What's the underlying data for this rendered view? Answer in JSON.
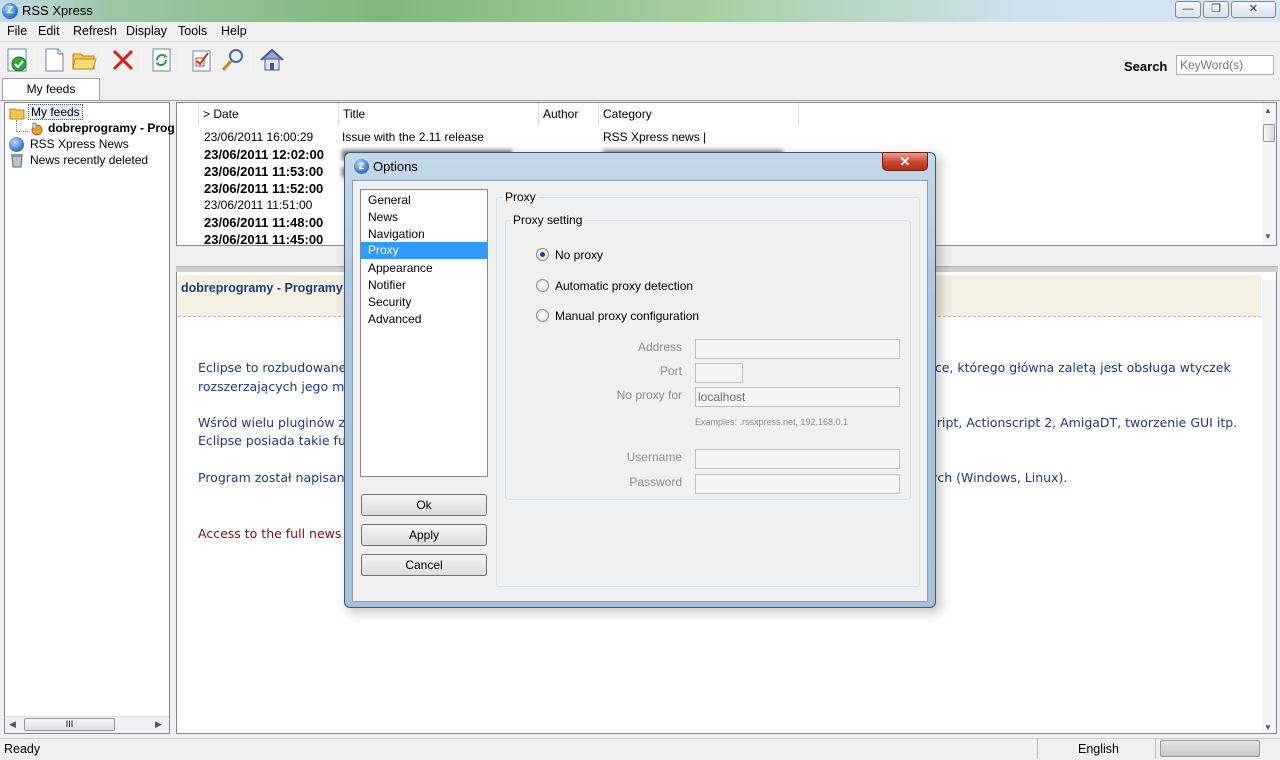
{
  "app": {
    "title": "RSS Xpress",
    "logo": "Z"
  },
  "window_controls": {
    "minimize": "—",
    "maximize": "❐",
    "close": "✕"
  },
  "menu": [
    "File",
    "Edit",
    "Refresh",
    "Display",
    "Tools",
    "Help"
  ],
  "toolbar": {
    "icons": [
      "check-feed-icon",
      "new-document-icon",
      "open-folder-icon",
      "delete-icon",
      "refresh-icon",
      "options-icon",
      "find-icon",
      "home-icon"
    ],
    "search_label": "Search",
    "search_placeholder": "KeyWord(s)"
  },
  "tabs": {
    "my_feeds": "My feeds"
  },
  "tree": {
    "root": "My feeds",
    "child": "dobreprogramy - Prog",
    "rss_news": "RSS Xpress News",
    "deleted": "News recently deleted",
    "scroll_thumb": "III"
  },
  "list": {
    "columns": [
      "> Date",
      "Title",
      "Author",
      "Category"
    ],
    "rows": [
      {
        "date": "23/06/2011 16:00:29",
        "title": "Issue with the 2.11 release",
        "author": "",
        "category": "RSS Xpress news |",
        "unread": false
      },
      {
        "date": "23/06/2011 12:02:00",
        "title": "",
        "author": "",
        "category": "",
        "unread": true
      },
      {
        "date": "23/06/2011 11:53:00",
        "title": "",
        "author": "",
        "category": "",
        "unread": true
      },
      {
        "date": "23/06/2011 11:52:00",
        "title": "",
        "author": "",
        "category": "",
        "unread": true
      },
      {
        "date": "23/06/2011 11:51:00",
        "title": "",
        "author": "",
        "category": "",
        "unread": false
      },
      {
        "date": "23/06/2011 11:48:00",
        "title": "",
        "author": "",
        "category": "",
        "unread": true
      },
      {
        "date": "23/06/2011 11:45:00",
        "title": "",
        "author": "",
        "category": "",
        "unread": true
      }
    ]
  },
  "preview": {
    "title": "dobreprogramy - Programy -",
    "p1a": "Eclipse to rozbudowane ś",
    "p1b": "rozszerzających jego moż",
    "p1c": "rce, którego główna zaletą jest obsługa wtyczek",
    "p2a": "Wśród wielu pluginów zna",
    "p2b": "Eclipse posiada takie fun",
    "p2c": "cript, Actionscript 2, AmigaDT, tworzenie GUI itp.",
    "p3a": "Program został napisany",
    "p3c": "ych (Windows, Linux).",
    "access": "Access to the full news"
  },
  "status": {
    "text": "Ready",
    "language": "English"
  },
  "dialog": {
    "title": "Options",
    "close": "✕",
    "categories": [
      "General",
      "News",
      "Navigation",
      "Proxy",
      "Appearance",
      "Notifier",
      "Security",
      "Advanced"
    ],
    "selected_category": "Proxy",
    "buttons": {
      "ok": "Ok",
      "apply": "Apply",
      "cancel": "Cancel"
    },
    "proxy": {
      "group_label": "Proxy",
      "setting_label": "Proxy setting",
      "options": [
        "No proxy",
        "Automatic proxy detection",
        "Manual proxy configuration"
      ],
      "selected_option": "No proxy",
      "fields": {
        "address_label": "Address",
        "address_value": "",
        "port_label": "Port",
        "port_value": "",
        "no_proxy_label": "No proxy for",
        "no_proxy_value": "localhost",
        "examples": "Examples: .rssxpress.net, 192.168.0.1",
        "username_label": "Username",
        "username_value": "",
        "password_label": "Password",
        "password_value": ""
      }
    }
  }
}
